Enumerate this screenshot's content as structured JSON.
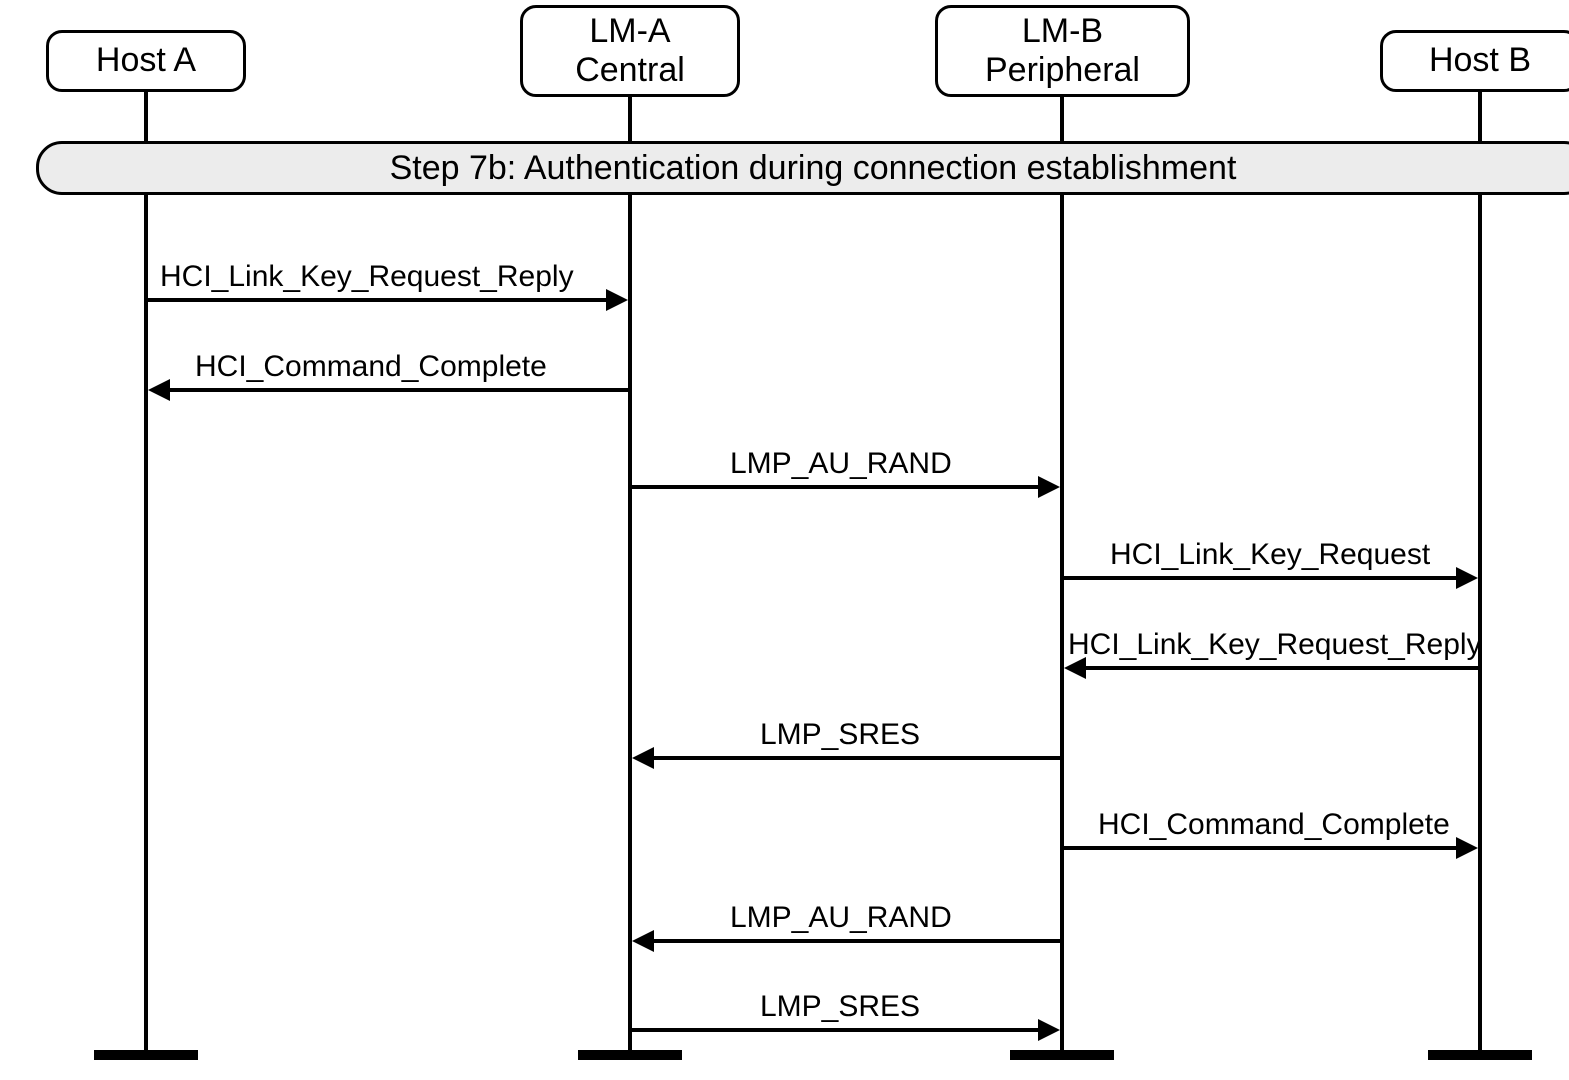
{
  "participants": {
    "hostA": {
      "label": "Host A"
    },
    "lmA": {
      "label": "LM-A\nCentral"
    },
    "lmB": {
      "label": "LM-B\nPeripheral"
    },
    "hostB": {
      "label": "Host B"
    }
  },
  "frame": {
    "label": "Step 7b:  Authentication during connection establishment"
  },
  "messages": {
    "m1": {
      "label": "HCI_Link_Key_Request_Reply"
    },
    "m2": {
      "label": "HCI_Command_Complete"
    },
    "m3": {
      "label": "LMP_AU_RAND"
    },
    "m4": {
      "label": "HCI_Link_Key_Request"
    },
    "m5": {
      "label": "HCI_Link_Key_Request_Reply"
    },
    "m6": {
      "label": "LMP_SRES"
    },
    "m7": {
      "label": "HCI_Command_Complete"
    },
    "m8": {
      "label": "LMP_AU_RAND"
    },
    "m9": {
      "label": "LMP_SRES"
    }
  }
}
